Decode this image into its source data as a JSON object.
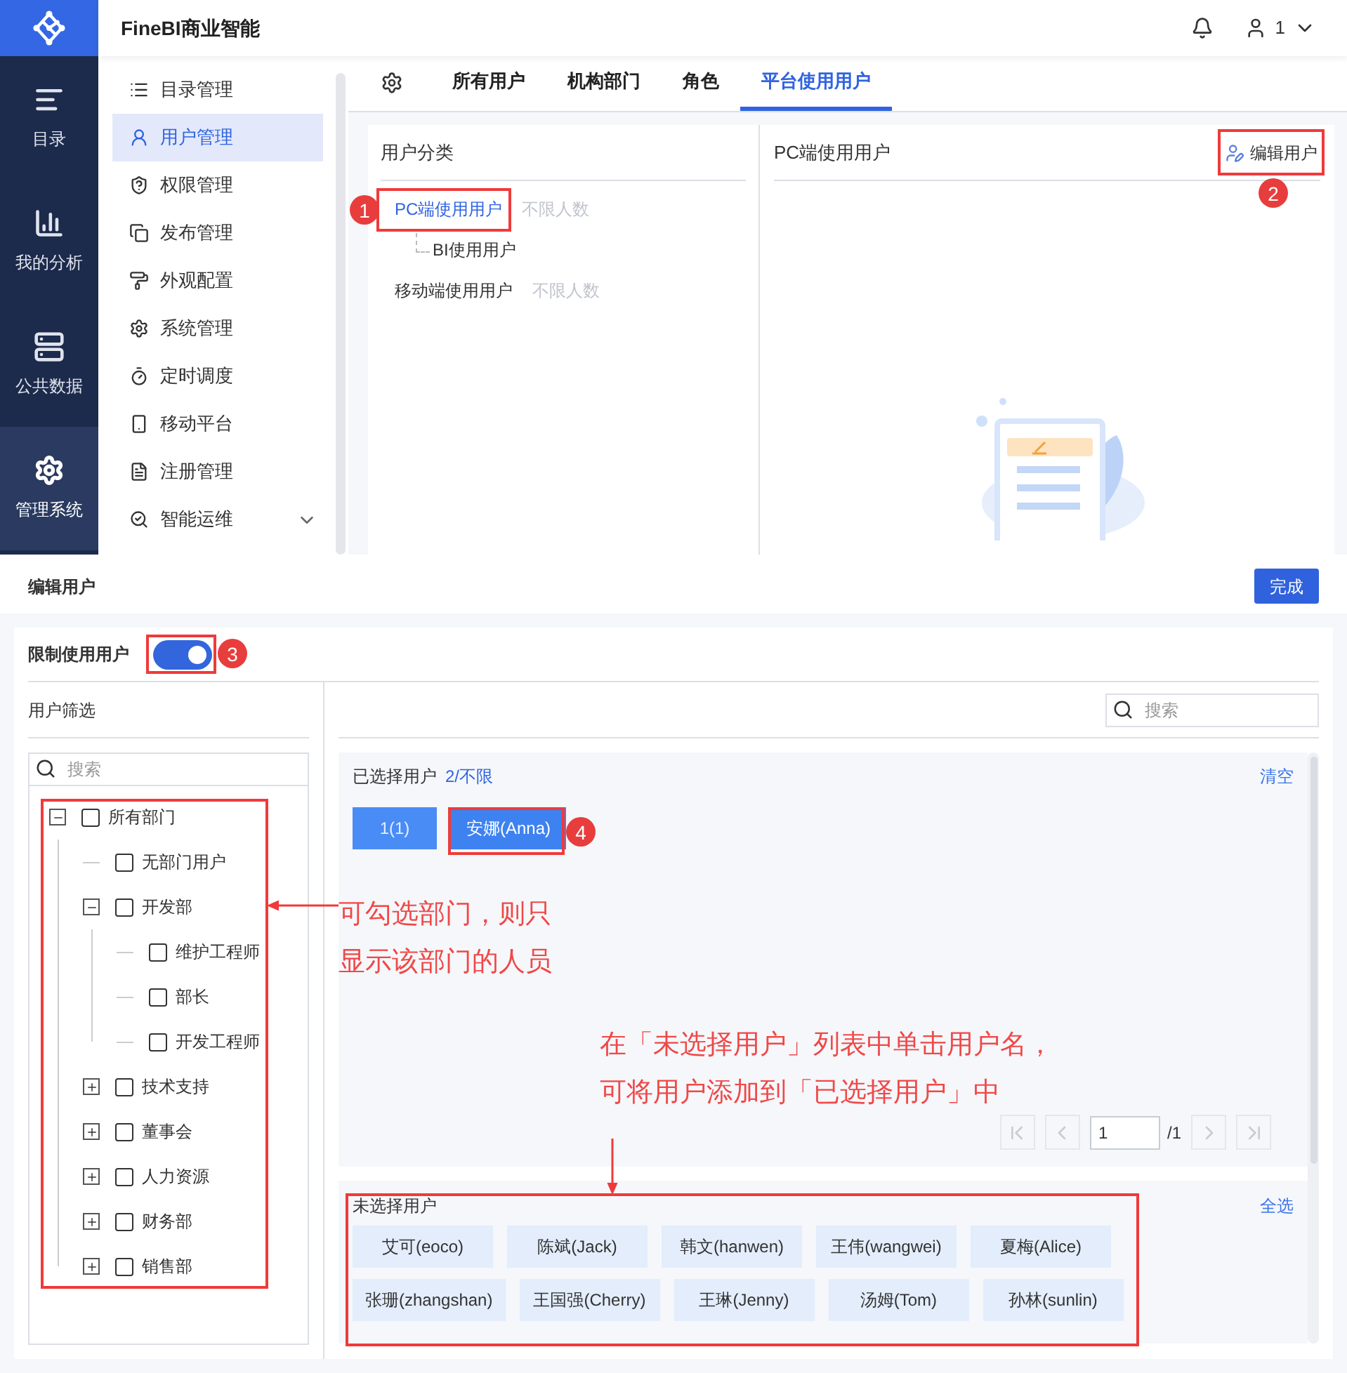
{
  "app": {
    "title": "FineBI商业智能",
    "user": "1"
  },
  "rail": [
    {
      "label": "目录",
      "selected": false
    },
    {
      "label": "我的分析",
      "selected": false
    },
    {
      "label": "公共数据",
      "selected": false
    },
    {
      "label": "管理系统",
      "selected": true
    }
  ],
  "menu": [
    {
      "label": "目录管理",
      "selected": false,
      "expandable": false
    },
    {
      "label": "用户管理",
      "selected": true,
      "expandable": false
    },
    {
      "label": "权限管理",
      "selected": false,
      "expandable": false
    },
    {
      "label": "发布管理",
      "selected": false,
      "expandable": false
    },
    {
      "label": "外观配置",
      "selected": false,
      "expandable": false
    },
    {
      "label": "系统管理",
      "selected": false,
      "expandable": false
    },
    {
      "label": "定时调度",
      "selected": false,
      "expandable": false
    },
    {
      "label": "移动平台",
      "selected": false,
      "expandable": false
    },
    {
      "label": "注册管理",
      "selected": false,
      "expandable": false
    },
    {
      "label": "智能运维",
      "selected": false,
      "expandable": true
    }
  ],
  "tabs": [
    {
      "label": "所有用户",
      "selected": false
    },
    {
      "label": "机构部门",
      "selected": false
    },
    {
      "label": "角色",
      "selected": false
    },
    {
      "label": "平台使用用户",
      "selected": true
    }
  ],
  "category_panel": {
    "title": "用户分类",
    "items": [
      {
        "label": "PC端使用用户",
        "note": "不限人数",
        "selected": true,
        "children": [
          {
            "label": "BI使用用户",
            "selected": false
          }
        ]
      },
      {
        "label": "移动端使用用户",
        "note": "不限人数",
        "selected": false
      }
    ]
  },
  "detail_panel": {
    "title": "PC端使用用户",
    "action": "编辑用户"
  },
  "editor": {
    "title": "编辑用户",
    "done": "完成",
    "restrict_label": "限制使用用户",
    "restrict_on": true,
    "filter_title": "用户筛选",
    "filter_search": {
      "placeholder": "搜索"
    },
    "tree": [
      {
        "label": "所有部门",
        "kind": "branch",
        "expanded": true,
        "checked": false,
        "children": [
          {
            "label": "无部门用户",
            "kind": "leaf",
            "checked": false
          },
          {
            "label": "开发部",
            "kind": "branch",
            "expanded": true,
            "checked": false,
            "children": [
              {
                "label": "维护工程师",
                "kind": "leaf",
                "checked": false
              },
              {
                "label": "部长",
                "kind": "leaf",
                "checked": false
              },
              {
                "label": "开发工程师",
                "kind": "leaf",
                "checked": false
              }
            ]
          },
          {
            "label": "技术支持",
            "kind": "branch",
            "expanded": false,
            "checked": false
          },
          {
            "label": "董事会",
            "kind": "branch",
            "expanded": false,
            "checked": false
          },
          {
            "label": "人力资源",
            "kind": "branch",
            "expanded": false,
            "checked": false
          },
          {
            "label": "财务部",
            "kind": "branch",
            "expanded": false,
            "checked": false
          },
          {
            "label": "销售部",
            "kind": "branch",
            "expanded": false,
            "checked": false
          }
        ]
      }
    ],
    "user_search": {
      "placeholder": "搜索"
    },
    "selected_users": {
      "title": "已选择用户",
      "count": "2/不限",
      "clear": "清空",
      "chips": [
        {
          "label": "1(1)",
          "kind": "faded"
        },
        {
          "label": "安娜(Anna)",
          "kind": "normal"
        }
      ],
      "pagination": {
        "page": "1",
        "total": "/1"
      }
    },
    "unselected_users": {
      "title": "未选择用户",
      "select_all": "全选",
      "users": [
        "艾可(eoco)",
        "陈斌(Jack)",
        "韩文(hanwen)",
        "王伟(wangwei)",
        "夏梅(Alice)",
        "张珊(zhangshan)",
        "王国强(Cherry)",
        "王琳(Jenny)",
        "汤姆(Tom)",
        "孙林(sunlin)"
      ]
    }
  },
  "annotations": {
    "markers": [
      "1",
      "2",
      "3",
      "4"
    ],
    "notes": [
      {
        "lines": [
          "可勾选部门，则只",
          "显示该部门的人员"
        ]
      },
      {
        "lines": [
          "在「未选择用户」列表中单击用户名，",
          "可将用户添加到「已选择用户」中"
        ]
      }
    ]
  }
}
